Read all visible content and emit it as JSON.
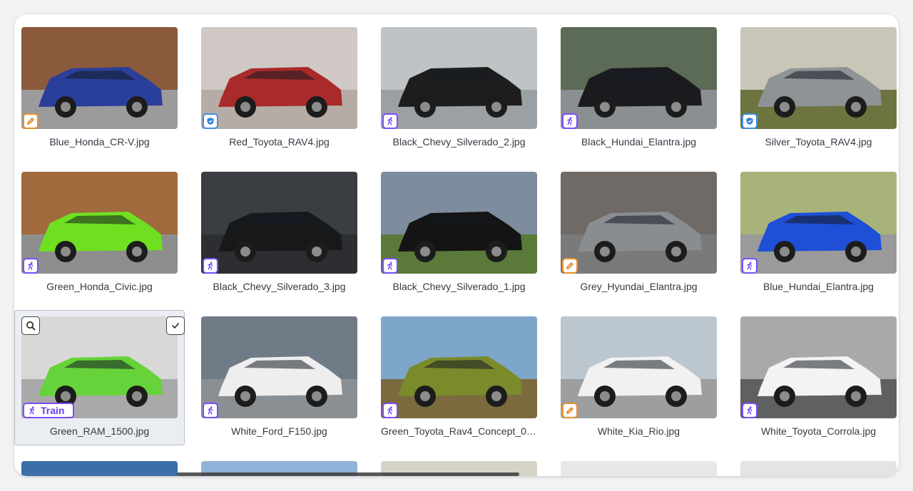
{
  "grid": {
    "items": [
      {
        "file": "Blue_Honda_CR-V.jpg",
        "badge": "pencil-icon",
        "badge_color": "orange",
        "body": "#2a3f9a",
        "bg": "#8b5a3c",
        "ground": "#9b9b9b"
      },
      {
        "file": "Red_Toyota_RAV4.jpg",
        "badge": "shield-icon",
        "badge_color": "blue",
        "body": "#a82a2a",
        "bg": "#cfc8c4",
        "ground": "#b5aca6"
      },
      {
        "file": "Black_Chevy_Silverado_2.jpg",
        "badge": "run-icon",
        "badge_color": "purple",
        "body": "#1d1d1d",
        "bg": "#bfc3c6",
        "ground": "#9aa0a3"
      },
      {
        "file": "Black_Hundai_Elantra.jpg",
        "badge": "run-icon",
        "badge_color": "purple",
        "body": "#1b1b1f",
        "bg": "#5b6b56",
        "ground": "#8a8f92"
      },
      {
        "file": "Silver_Toyota_RAV4.jpg",
        "badge": "shield-icon",
        "badge_color": "blue",
        "body": "#8e9396",
        "bg": "#c8c6b6",
        "ground": "#6d7440"
      },
      {
        "file": "Green_Honda_Civic.jpg",
        "badge": "run-icon",
        "badge_color": "purple",
        "body": "#6fe021",
        "bg": "#a06a3c",
        "ground": "#8d8d8d"
      },
      {
        "file": "Black_Chevy_Silverado_3.jpg",
        "badge": "run-icon",
        "badge_color": "purple",
        "body": "#17181a",
        "bg": "#3a3d42",
        "ground": "#2c2e31"
      },
      {
        "file": "Black_Chevy_Silverado_1.jpg",
        "badge": "run-icon",
        "badge_color": "purple",
        "body": "#141414",
        "bg": "#7d8d9e",
        "ground": "#5b7a3a"
      },
      {
        "file": "Grey_Hyundai_Elantra.jpg",
        "badge": "pencil-icon",
        "badge_color": "orange",
        "body": "#8a8d90",
        "bg": "#6f6a66",
        "ground": "#7a7a7a"
      },
      {
        "file": "Blue_Hundai_Elantra.jpg",
        "badge": "run-icon",
        "badge_color": "purple",
        "body": "#1f4fd6",
        "bg": "#a8b37a",
        "ground": "#9a9a9a"
      },
      {
        "file": "Green_RAM_1500.jpg",
        "badge": "run-icon",
        "badge_color": "purple",
        "badge_label": "Train",
        "selected": true,
        "body": "#66d33a",
        "bg": "#d8d8d8",
        "ground": "#a9a9a9"
      },
      {
        "file": "White_Ford_F150.jpg",
        "badge": "run-icon",
        "badge_color": "purple",
        "body": "#eeeeee",
        "bg": "#6f7b86",
        "ground": "#8a8f93"
      },
      {
        "file": "Green_Toyota_Rav4_Concept_02...",
        "badge": "run-icon",
        "badge_color": "purple",
        "body": "#7b8a2a",
        "bg": "#7ea6c8",
        "ground": "#7a6a3e"
      },
      {
        "file": "White_Kia_Rio.jpg",
        "badge": "pencil-icon",
        "badge_color": "orange",
        "body": "#f1f1f1",
        "bg": "#bcc6cf",
        "ground": "#9c9ea0"
      },
      {
        "file": "White_Toyota_Corrola.jpg",
        "badge": "run-icon",
        "badge_color": "purple",
        "body": "#f3f3f3",
        "bg": "#a7a9ab",
        "ground": "#5e6062"
      }
    ],
    "next_row": [
      {
        "color": "#3c6ea8"
      },
      {
        "color": "#8fb3d8"
      },
      {
        "color": "#d6d3c8"
      },
      {
        "color": "#e8e8e8"
      },
      {
        "color": "#e4e4e4"
      }
    ]
  }
}
